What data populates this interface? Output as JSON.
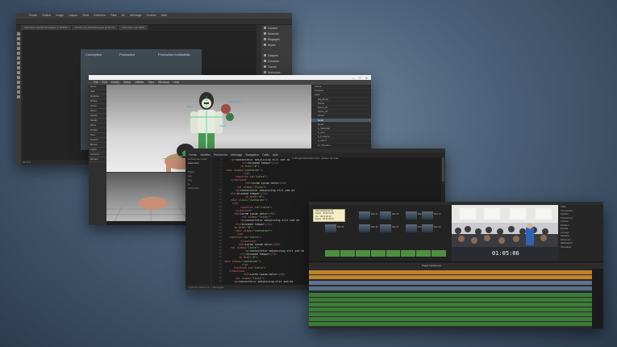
{
  "scene": "collage of creative software windows",
  "colors": {
    "background": "#4a6078",
    "photoshop_bg": "#2b2b2b",
    "modeling_bg": "#3a3a3a",
    "code_bg": "#1c1c1c",
    "video_bg": "#1d1d1d",
    "audio_track": "#3f8a3a",
    "music_track": "#c8882e",
    "title_track": "#6a7fa8",
    "tooltip": "#f4eec6"
  },
  "photoshop": {
    "menu": [
      "Fichier",
      "Edition",
      "Image",
      "Calque",
      "Texte",
      "Sélection",
      "Filtre",
      "3D",
      "Affichage",
      "Fenêtre",
      "Aide"
    ],
    "options_label": "Largeur",
    "tabs": [
      "Sans titre-1 @ 66,7% (Calque 1, RVB/8)",
      "Tutoriel_v1_Photoshop.psd @ 66,7%",
      "Sans titre-2 @ 100%"
    ],
    "panels": [
      "Couleur",
      "Nuancier",
      "Réglages",
      "Styles",
      "Calques",
      "Couches",
      "Tracés",
      "Historique"
    ],
    "ghost_tabs": [
      "Conception",
      "Production",
      "Production multimédia"
    ],
    "status": "66,67%"
  },
  "modeling": {
    "title": "Layout3* (Test_Rigs.lightWave) - LW 2015 - Modeler",
    "menu": [
      "File",
      "Edit",
      "Modify",
      "Setup",
      "Utilities",
      "View",
      "Windows",
      "Help"
    ],
    "left_tools": [
      "Items",
      "Add",
      "Replace",
      "Delete",
      "Clone",
      "Mirror",
      "Motion",
      "Modify",
      "Move",
      "Rotate",
      "Size",
      "Stretch",
      "Bones",
      "Lights",
      "Camera",
      "Render"
    ],
    "scene_items": [
      "Scene",
      "Camera",
      "Light",
      "Rig_Body",
      "Pelvis",
      "Spine_01",
      "Spine_02",
      "Chest",
      "Neck",
      "Head",
      "L_Shoulder",
      "L_Arm",
      "L_Forearm",
      "L_Hand",
      "R_Shoulder",
      "R_Arm",
      "R_Forearm",
      "R_Hand",
      "L_Thigh",
      "L_Shin",
      "L_Foot",
      "R_Thigh",
      "R_Shin",
      "R_Foot",
      "Dog_Rig",
      "Dog_Spine",
      "Dog_Head",
      "Dog_Tail",
      "Null_01",
      "Null_02",
      "Ground",
      "Backdrop"
    ],
    "selected_item": "Neck",
    "position_label": "Position"
  },
  "code": {
    "title": "C:\\Projets\\Site\\index.html - Éditeur de code",
    "menu": [
      "Fichier",
      "Modifier",
      "Recherche",
      "Affichage",
      "Navigation",
      "Outils",
      "Aide"
    ],
    "sidebar": [
      "Fichiers de travail",
      "index.html",
      "Projet",
      "css",
      "img",
      "js",
      "index.html"
    ],
    "status": "Ligne 8, Colonne 2 — 162 lignes"
  },
  "video": {
    "tooltip": [
      "Clip Conférence 01",
      "Début : 00:00:12:05",
      "Fin : 00:01:48:19",
      "Durée : 00:01:36:14"
    ],
    "clip_names": [
      "Plan 01",
      "Plan 02",
      "Plan 03",
      "Plan 04",
      "Plan 05",
      "Plan 06",
      "Plan 07",
      "Plan 08",
      "Plan 09"
    ],
    "timecode": "01:05:06",
    "inspector": [
      "Vidéo",
      "Composition",
      "Opacité",
      "Transformer",
      "Position",
      "Rotation",
      "Échelle",
      "Ancrage",
      "Recadrer",
      "Distorsion",
      "Stabilisation",
      "Obturateur"
    ],
    "timeline_label": "Projet Conférence"
  }
}
